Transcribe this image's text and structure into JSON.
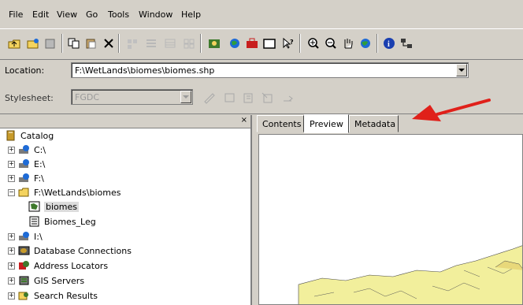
{
  "menu": [
    {
      "label": "File"
    },
    {
      "label": "Edit"
    },
    {
      "label": "View"
    },
    {
      "label": "Go"
    },
    {
      "label": "Tools"
    },
    {
      "label": "Window"
    },
    {
      "label": "Help"
    }
  ],
  "location": {
    "label": "Location:",
    "value": "F:\\WetLands\\biomes\\biomes.shp"
  },
  "stylesheet": {
    "label": "Stylesheet:",
    "value": "FGDC"
  },
  "tree": {
    "items": [
      {
        "label": "Catalog"
      },
      {
        "label": "C:\\"
      },
      {
        "label": "E:\\"
      },
      {
        "label": "F:\\"
      },
      {
        "label": "F:\\WetLands\\biomes"
      },
      {
        "label": "biomes"
      },
      {
        "label": "Biomes_Leg"
      },
      {
        "label": "I:\\"
      },
      {
        "label": "Database Connections"
      },
      {
        "label": "Address Locators"
      },
      {
        "label": "GIS Servers"
      },
      {
        "label": "Search Results"
      }
    ]
  },
  "tabs": [
    {
      "label": "Contents"
    },
    {
      "label": "Preview"
    },
    {
      "label": "Metadata"
    }
  ],
  "colors": {
    "arrow": "#e0201a",
    "map_fill": "#f2ef9c"
  }
}
